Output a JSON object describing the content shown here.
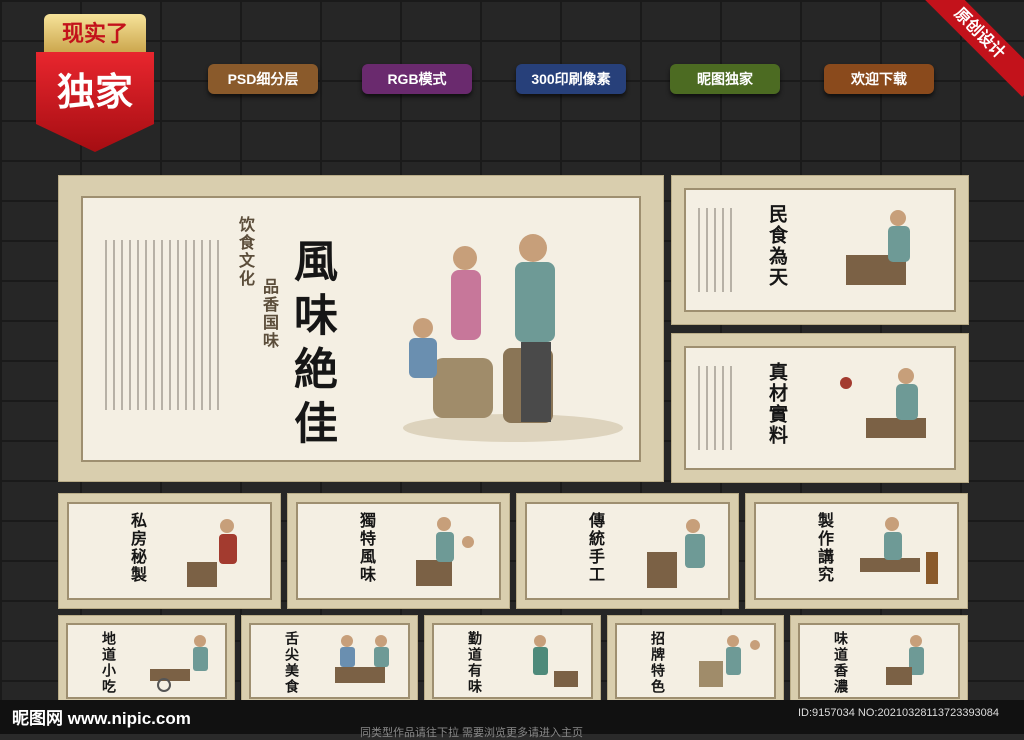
{
  "badge": {
    "top": "现实了",
    "main": "独家"
  },
  "tags": [
    {
      "label": "PSD细分层",
      "color": "#8a5a2b"
    },
    {
      "label": "RGB模式",
      "color": "#6a2a6e"
    },
    {
      "label": "300印刷像素",
      "color": "#27407a"
    },
    {
      "label": "昵图独家",
      "color": "#4c6b22"
    },
    {
      "label": "欢迎下载",
      "color": "#8a4a1c"
    }
  ],
  "corner_label": "原创设计",
  "main_panel": {
    "title": "風味絶佳",
    "brand_a": "饮食文化",
    "brand_b": "品香国味"
  },
  "small_titles": [
    "民食為天",
    "真材實料",
    "私房秘製",
    "獨特風味",
    "傳統手工",
    "製作講究",
    "地道小吃",
    "舌尖美食",
    "勤道有味",
    "招牌特色",
    "味道香濃"
  ],
  "footer": {
    "logo": "昵图网 www.nipic.com",
    "id": "ID:9157034 NO:20210328113723393084",
    "tip": "同类型作品请往下拉   需要浏览更多请进入主页"
  }
}
